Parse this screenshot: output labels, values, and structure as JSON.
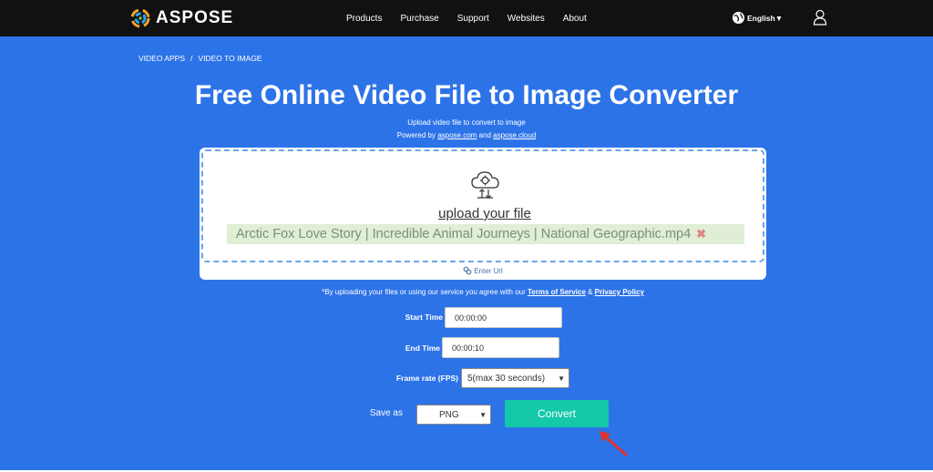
{
  "header": {
    "brand": "ASPOSE",
    "nav": [
      "Products",
      "Purchase",
      "Support",
      "Websites",
      "About"
    ],
    "language": "English▼",
    "icons": {
      "logo": "aspose-logo-icon",
      "globe": "globe-icon",
      "user": "user-icon"
    }
  },
  "breadcrumb": [
    "VIDEO APPS",
    "/",
    "VIDEO TO IMAGE"
  ],
  "hero": {
    "title": "Free Online Video File to Image Converter",
    "subtitle": "Upload video file to convert to image",
    "powered_prefix": "Powered by ",
    "powered_link1": "aspose.com",
    "powered_and": " and ",
    "powered_link2": "aspose.cloud"
  },
  "upload": {
    "link_text": "upload your file",
    "file_name": "Arctic Fox Love Story  |  Incredible Animal Journeys  |  National Geographic.mp4",
    "remove_glyph": "✖",
    "enter_url": "Enter Url"
  },
  "agreement": {
    "prefix": "*By uploading your files or using our service you agree with our ",
    "terms": "Terms of Service",
    "amp": " & ",
    "privacy": "Privacy Policy"
  },
  "form": {
    "start_label": "Start Time",
    "start_value": "00:00:00",
    "end_label": "End Time",
    "end_value": "00:00:10",
    "fps_label": "Frame rate (FPS)",
    "fps_value": "5(max 30 seconds)",
    "save_label": "Save as",
    "save_value": "PNG",
    "convert_label": "Convert"
  },
  "colors": {
    "hero_bg": "#2d73e8",
    "topbar_bg": "#111111",
    "convert_bg": "#14c8a8",
    "arrow": "#e0332e"
  }
}
